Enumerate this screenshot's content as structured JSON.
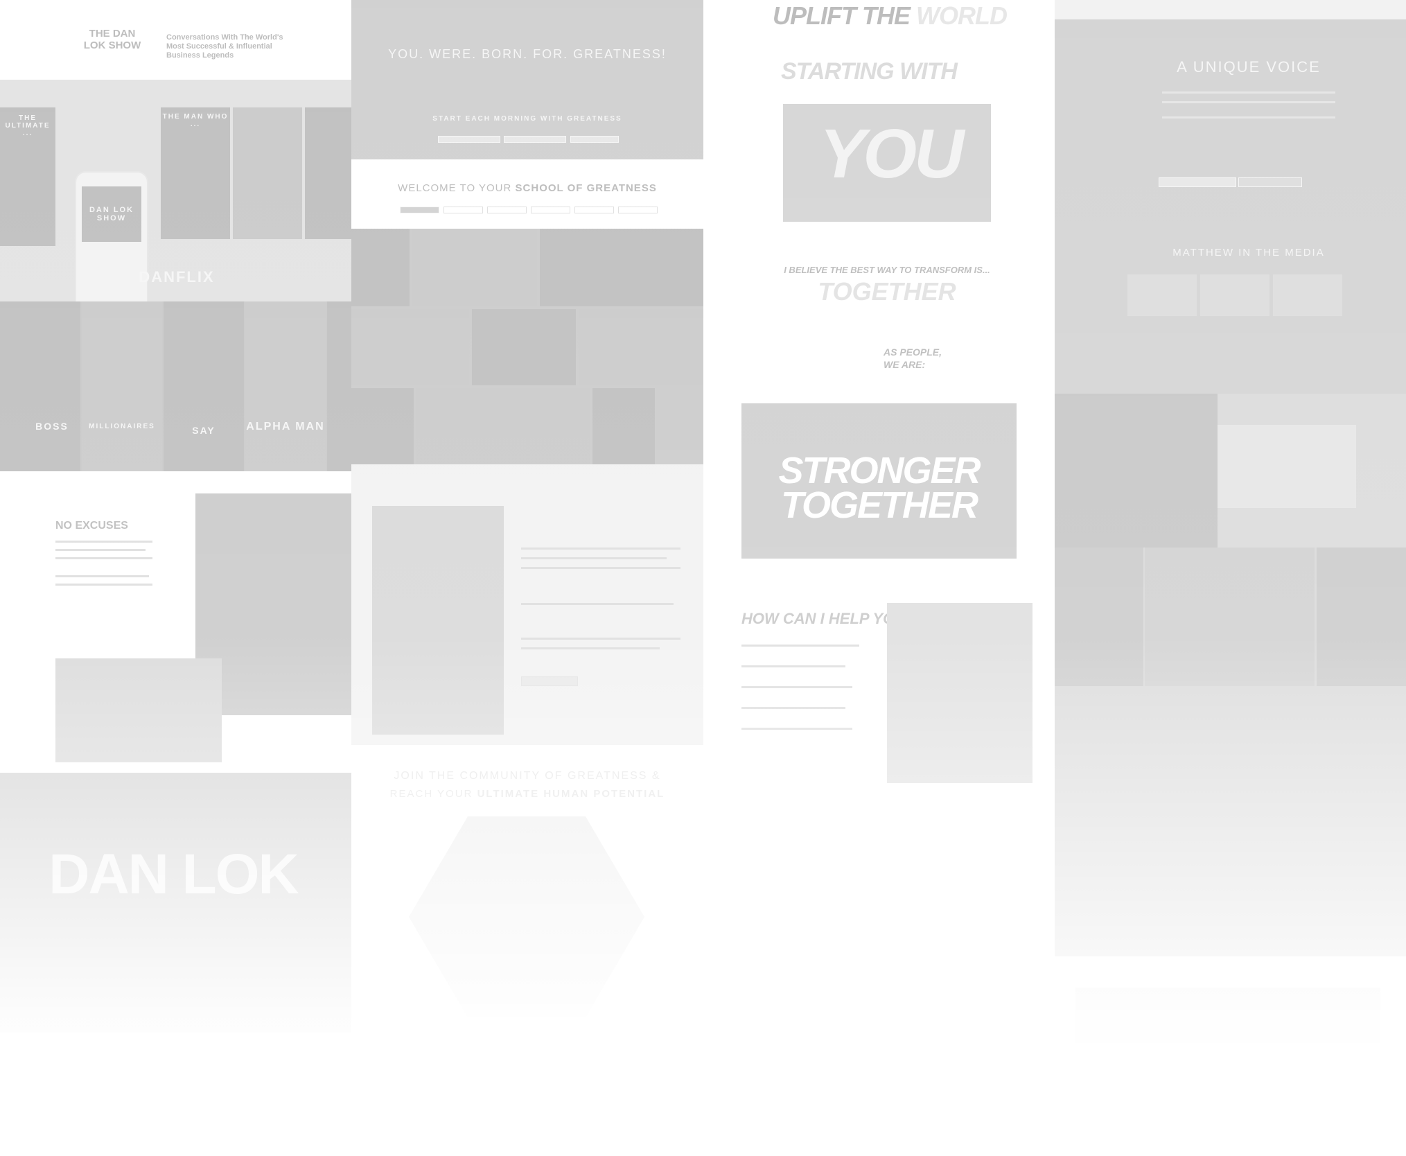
{
  "col1": {
    "show_title": "THE DAN LOK SHOW",
    "show_tagline": "Conversations With The World's Most Successful & Influential Business Legends",
    "phone_show_title": "DAN LOK SHOW",
    "card_labels": [
      "THE ULTIMATE ...",
      "THE MAN WHO ..."
    ],
    "danflix": "DANFLIX",
    "tiles": [
      "BOSS",
      "MILLIONAIRES",
      "SAY",
      "ALPHA MAN"
    ],
    "no_excuses": "NO EXCUSES",
    "big_name": "DAN LOK"
  },
  "col2": {
    "hero": "YOU. WERE. BORN. FOR. GREATNESS!",
    "morning": "START EACH MORNING WITH GREATNESS",
    "welcome_prefix": "WELCOME TO YOUR",
    "welcome_emph": "SCHOOL OF GREATNESS",
    "community_line1": "JOIN THE COMMUNITY OF GREATNESS &",
    "community_line2_prefix": "REACH YOUR",
    "community_line2_emph": "ULTIMATE HUMAN POTENTIAL"
  },
  "col3": {
    "uplift": "UPLIFT THE",
    "world": "WORLD",
    "starting_with": "STARTING WITH",
    "you": "YOU",
    "believe": "I BELIEVE THE BEST WAY TO TRANSFORM IS...",
    "together": "TOGETHER",
    "as_people_1": "AS PEOPLE,",
    "as_people_2": "WE ARE:",
    "stronger": "STRONGER",
    "together2": "TOGETHER",
    "help": "HOW CAN I HELP YOU?"
  },
  "col4": {
    "unique_voice": "A UNIQUE VOICE",
    "media": "MATTHEW IN THE MEDIA"
  }
}
